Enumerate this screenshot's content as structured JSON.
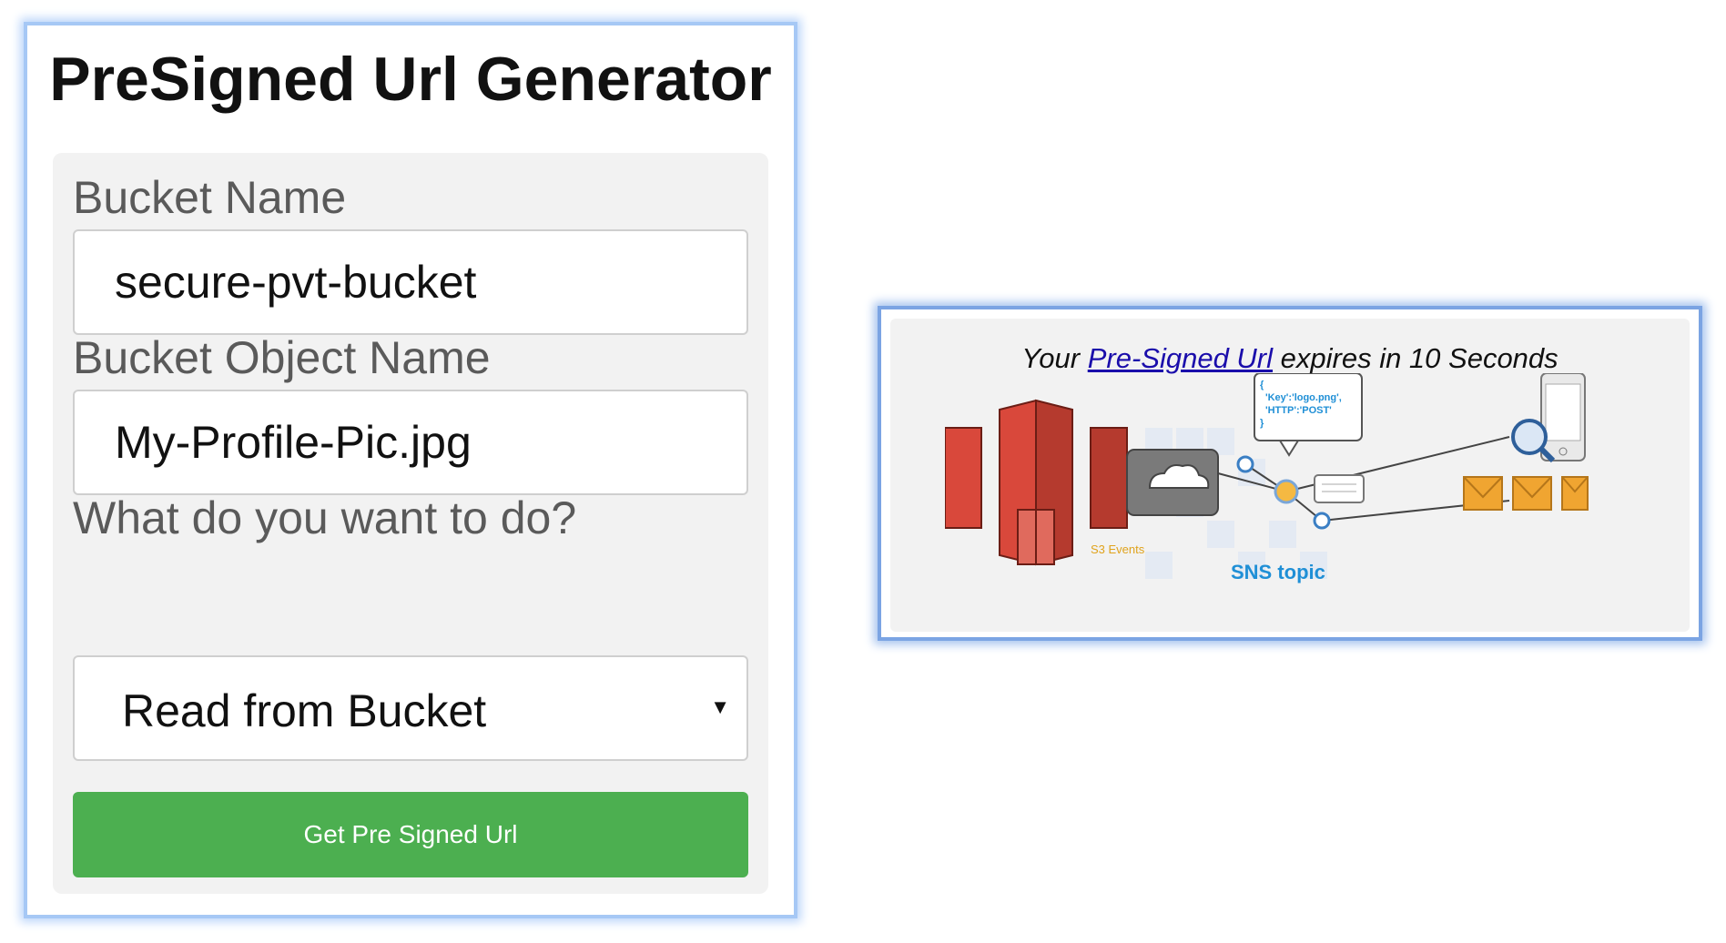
{
  "generator": {
    "title": "PreSigned Url Generator",
    "bucket_label": "Bucket Name",
    "bucket_value": "secure-pvt-bucket",
    "object_label": "Bucket Object Name",
    "object_value": "My-Profile-Pic.jpg",
    "action_label": "What do you want to do?",
    "action_selected": "Read from Bucket",
    "submit_label": "Get Pre Signed Url"
  },
  "result": {
    "msg_prefix": "Your ",
    "link_text": "Pre-Signed Url",
    "msg_suffix": " expires in 10 Seconds"
  },
  "diagram": {
    "s3_caption": "S3 Events",
    "sns_caption": "SNS topic",
    "code_line1": "{",
    "code_line2": "'Key':'logo.png',",
    "code_line3": "'HTTP':'POST'",
    "code_line4": "}"
  },
  "colors": {
    "accent_green": "#4caf50",
    "link_blue": "#1a0dab",
    "s3_red": "#d9483b",
    "sns_blue": "#1f8fd6",
    "envelope_orange": "#f0a531"
  }
}
